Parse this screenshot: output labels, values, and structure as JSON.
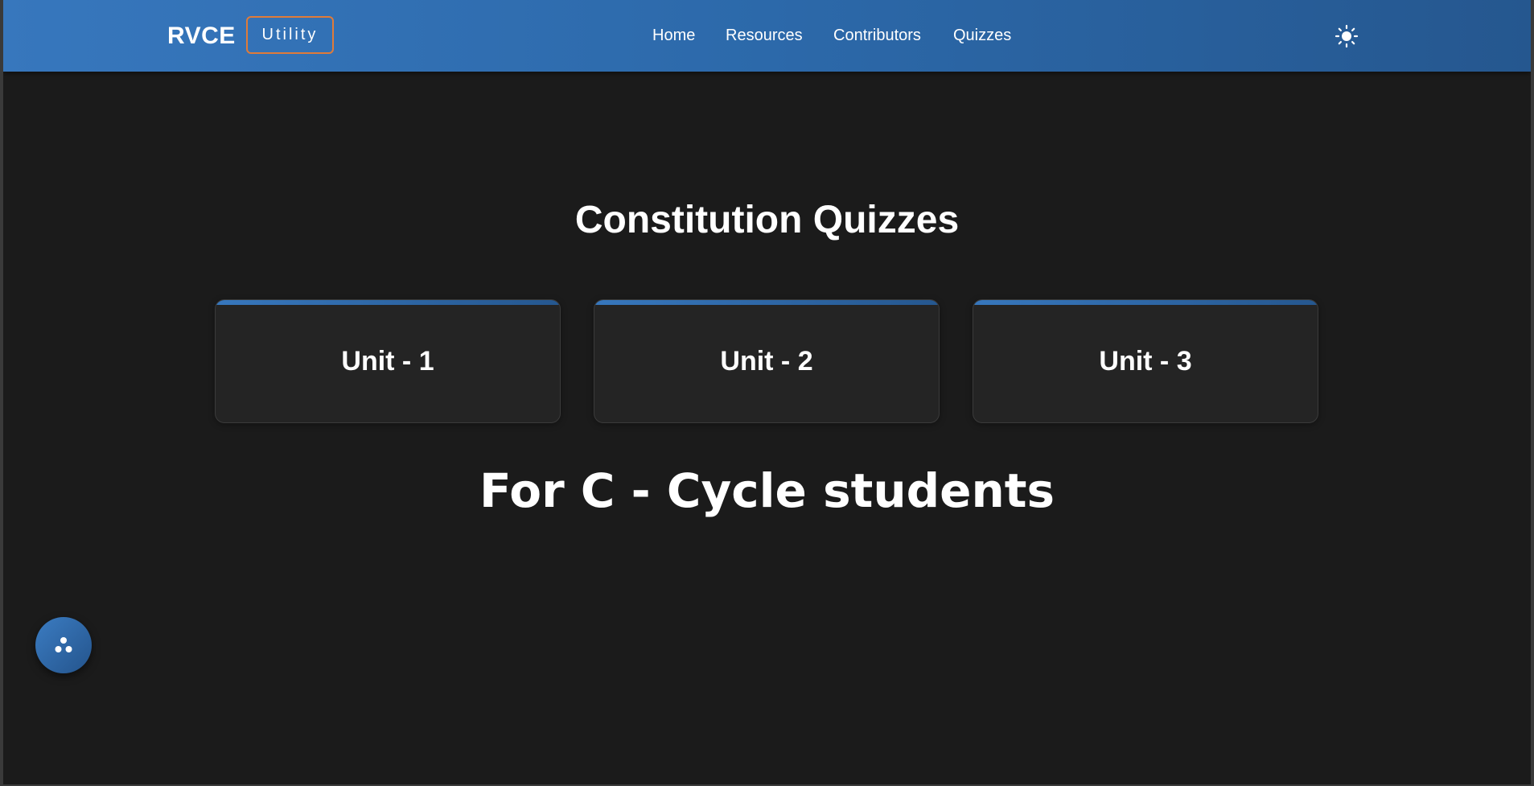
{
  "navbar": {
    "brand": "RVCE",
    "badge": "Utility",
    "links": [
      {
        "label": "Home"
      },
      {
        "label": "Resources"
      },
      {
        "label": "Contributors"
      },
      {
        "label": "Quizzes"
      }
    ],
    "theme_icon": "sun-icon"
  },
  "main": {
    "title": "Constitution Quizzes",
    "cards": [
      {
        "label": "Unit - 1"
      },
      {
        "label": "Unit - 2"
      },
      {
        "label": "Unit - 3"
      }
    ],
    "subtitle": "For C - Cycle students"
  },
  "fab": {
    "icon": "three-dots-cluster-icon"
  },
  "colors": {
    "background": "#1b1b1b",
    "navbar_gradient_start": "#3777bd",
    "navbar_gradient_end": "#25578f",
    "badge_border": "#e07b39",
    "card_background": "#242424",
    "text": "#ffffff"
  }
}
